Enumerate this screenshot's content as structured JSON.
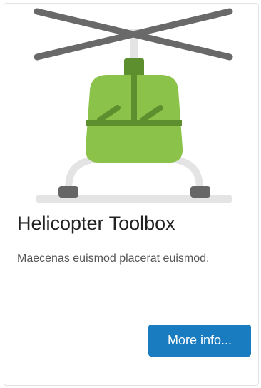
{
  "card": {
    "title": "Helicopter Toolbox",
    "description": "Maecenas euismod placerat euismod.",
    "button_label": "More info..."
  },
  "illustration": {
    "icon": "helicopter-icon",
    "colors": {
      "body": "#8bc34a",
      "body_dark": "#5d8f2f",
      "rotor": "#696969",
      "skid": "#e4e4e4",
      "foot": "#666666"
    }
  },
  "colors": {
    "button": "#1a7cc0",
    "title": "#222222",
    "text": "#555555"
  }
}
